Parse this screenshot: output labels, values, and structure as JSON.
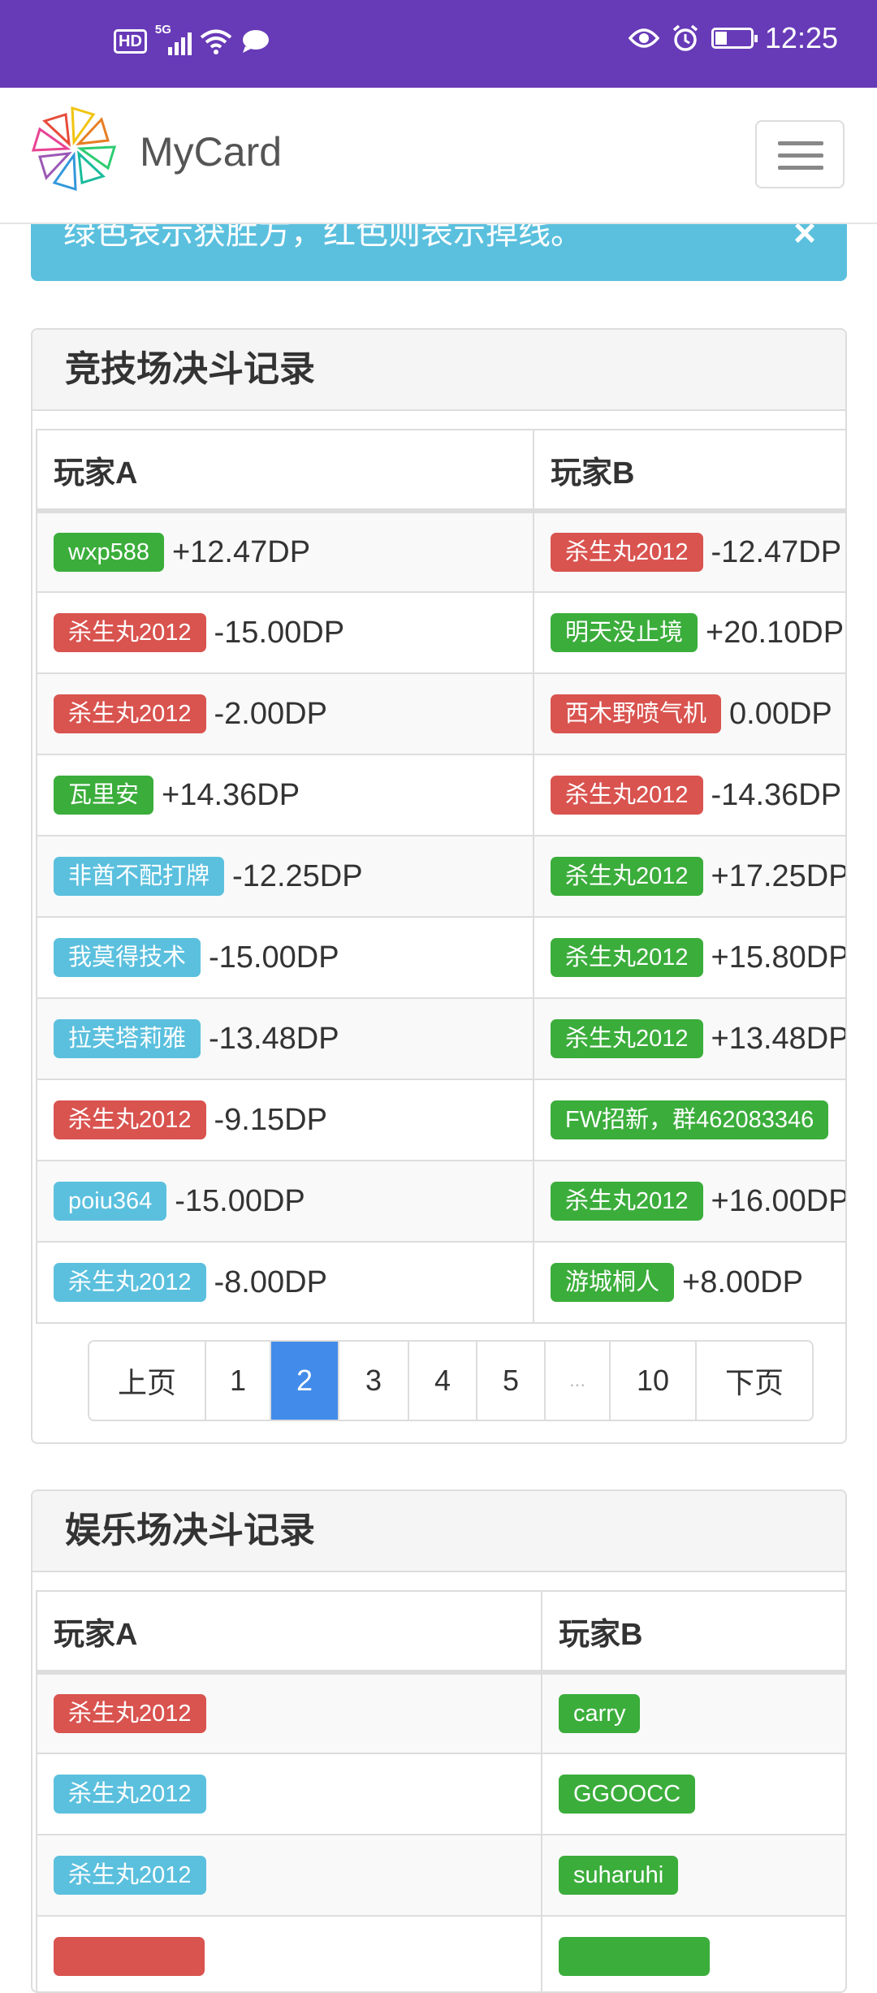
{
  "status_bar": {
    "left_icons": [
      "hd-icon",
      "5g-signal-icon",
      "wifi-icon",
      "chat-bubble-icon"
    ],
    "hd_text": "HD",
    "network_text": "5G",
    "time": "12:25",
    "battery_level": 0.3
  },
  "navbar": {
    "brand": "MyCard"
  },
  "alert": {
    "text": "绿色表示获胜方，红色则表示掉线。",
    "close": "×"
  },
  "arena": {
    "title": "竞技场决斗记录",
    "columns": [
      "玩家A",
      "玩家B"
    ],
    "rows": [
      {
        "a_name": "wxp588",
        "a_color": "green",
        "a_dp": "+12.47DP",
        "b_name": "杀生丸2012",
        "b_color": "red",
        "b_dp": "-12.47DP"
      },
      {
        "a_name": "杀生丸2012",
        "a_color": "red",
        "a_dp": "-15.00DP",
        "b_name": "明天没止境",
        "b_color": "green",
        "b_dp": "+20.10DP"
      },
      {
        "a_name": "杀生丸2012",
        "a_color": "red",
        "a_dp": "-2.00DP",
        "b_name": "西木野喷气机",
        "b_color": "red",
        "b_dp": "0.00DP"
      },
      {
        "a_name": "瓦里安",
        "a_color": "green",
        "a_dp": "+14.36DP",
        "b_name": "杀生丸2012",
        "b_color": "red",
        "b_dp": "-14.36DP"
      },
      {
        "a_name": "非酋不配打牌",
        "a_color": "blue",
        "a_dp": "-12.25DP",
        "b_name": "杀生丸2012",
        "b_color": "green",
        "b_dp": "+17.25DP"
      },
      {
        "a_name": "我莫得技术",
        "a_color": "blue",
        "a_dp": "-15.00DP",
        "b_name": "杀生丸2012",
        "b_color": "green",
        "b_dp": "+15.80DP"
      },
      {
        "a_name": "拉芙塔莉雅",
        "a_color": "blue",
        "a_dp": "-13.48DP",
        "b_name": "杀生丸2012",
        "b_color": "green",
        "b_dp": "+13.48DP"
      },
      {
        "a_name": "杀生丸2012",
        "a_color": "red",
        "a_dp": "-9.15DP",
        "b_name": "FW招新，群462083346",
        "b_color": "green",
        "b_dp": ""
      },
      {
        "a_name": "poiu364",
        "a_color": "blue",
        "a_dp": "-15.00DP",
        "b_name": "杀生丸2012",
        "b_color": "green",
        "b_dp": "+16.00DP"
      },
      {
        "a_name": "杀生丸2012",
        "a_color": "blue",
        "a_dp": "-8.00DP",
        "b_name": "游城桐人",
        "b_color": "green",
        "b_dp": "+8.00DP"
      }
    ],
    "pagination": {
      "prev": "上页",
      "pages": [
        "1",
        "2",
        "3",
        "4",
        "5",
        "...",
        "10"
      ],
      "active": "2",
      "next": "下页"
    }
  },
  "casual": {
    "title": "娱乐场决斗记录",
    "columns": [
      "玩家A",
      "玩家B"
    ],
    "rows": [
      {
        "a_name": "杀生丸2012",
        "a_color": "red",
        "b_name": "carry",
        "b_color": "green"
      },
      {
        "a_name": "杀生丸2012",
        "a_color": "blue",
        "b_name": "GGOOCC",
        "b_color": "green"
      },
      {
        "a_name": "杀生丸2012",
        "a_color": "blue",
        "b_name": "suharuhi",
        "b_color": "green"
      },
      {
        "a_name": "",
        "a_color": "red",
        "b_name": "",
        "b_color": "green"
      }
    ]
  }
}
